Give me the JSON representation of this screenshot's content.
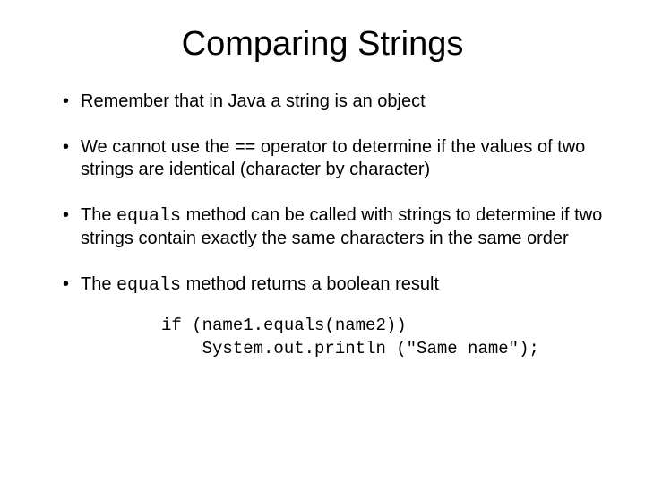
{
  "title": "Comparing Strings",
  "bullets": {
    "b1": "Remember that in Java a string is an object",
    "b2": "We cannot use the == operator to determine if the values of two strings are identical (character by character)",
    "b3_pre": "The ",
    "b3_code": "equals",
    "b3_post": " method can be called with strings to determine if two strings contain exactly the same characters in the same order",
    "b4_pre": "The ",
    "b4_code": "equals",
    "b4_post": " method returns a boolean result"
  },
  "code": "if (name1.equals(name2))\n    System.out.println (\"Same name\");"
}
